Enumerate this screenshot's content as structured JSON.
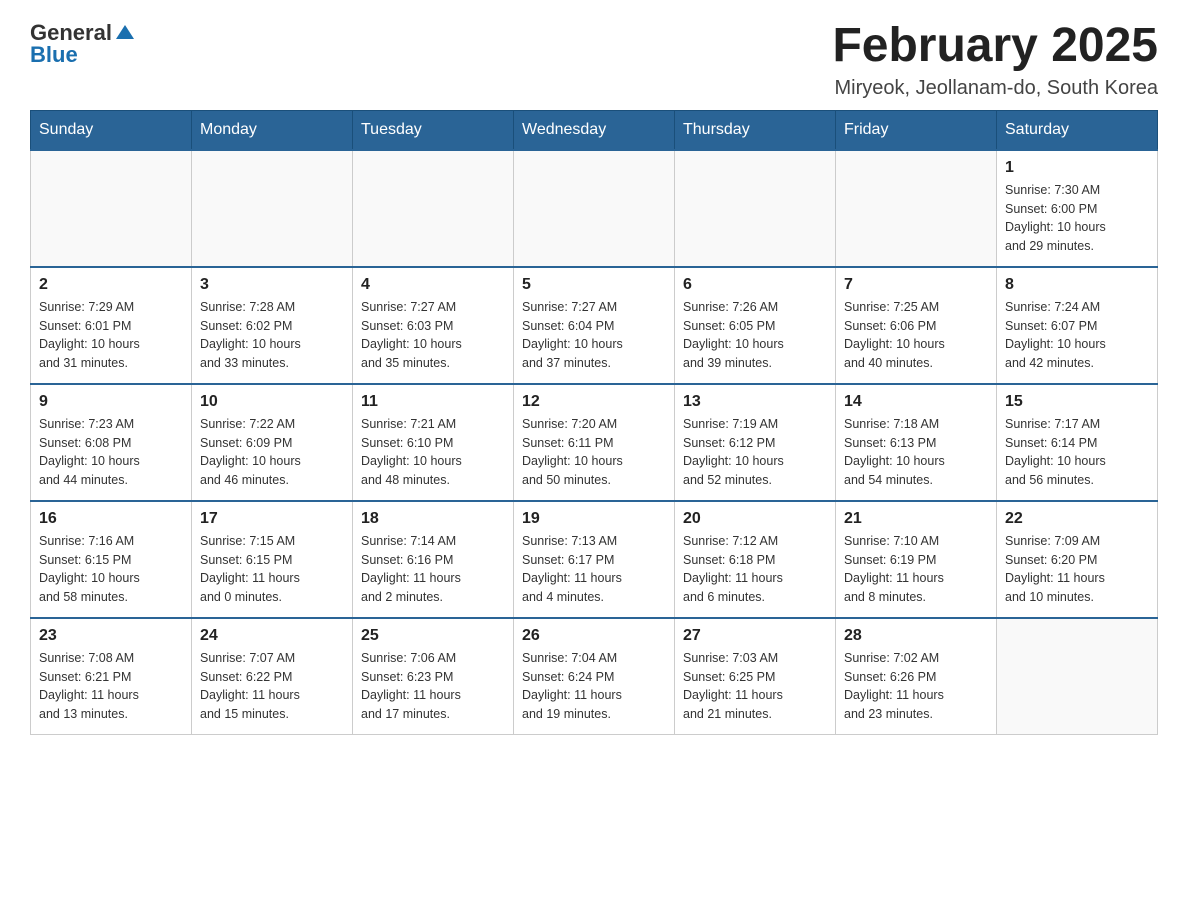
{
  "header": {
    "logo_general": "General",
    "logo_blue": "Blue",
    "month_title": "February 2025",
    "location": "Miryeok, Jeollanam-do, South Korea"
  },
  "weekdays": [
    "Sunday",
    "Monday",
    "Tuesday",
    "Wednesday",
    "Thursday",
    "Friday",
    "Saturday"
  ],
  "weeks": [
    [
      {
        "day": "",
        "info": ""
      },
      {
        "day": "",
        "info": ""
      },
      {
        "day": "",
        "info": ""
      },
      {
        "day": "",
        "info": ""
      },
      {
        "day": "",
        "info": ""
      },
      {
        "day": "",
        "info": ""
      },
      {
        "day": "1",
        "info": "Sunrise: 7:30 AM\nSunset: 6:00 PM\nDaylight: 10 hours\nand 29 minutes."
      }
    ],
    [
      {
        "day": "2",
        "info": "Sunrise: 7:29 AM\nSunset: 6:01 PM\nDaylight: 10 hours\nand 31 minutes."
      },
      {
        "day": "3",
        "info": "Sunrise: 7:28 AM\nSunset: 6:02 PM\nDaylight: 10 hours\nand 33 minutes."
      },
      {
        "day": "4",
        "info": "Sunrise: 7:27 AM\nSunset: 6:03 PM\nDaylight: 10 hours\nand 35 minutes."
      },
      {
        "day": "5",
        "info": "Sunrise: 7:27 AM\nSunset: 6:04 PM\nDaylight: 10 hours\nand 37 minutes."
      },
      {
        "day": "6",
        "info": "Sunrise: 7:26 AM\nSunset: 6:05 PM\nDaylight: 10 hours\nand 39 minutes."
      },
      {
        "day": "7",
        "info": "Sunrise: 7:25 AM\nSunset: 6:06 PM\nDaylight: 10 hours\nand 40 minutes."
      },
      {
        "day": "8",
        "info": "Sunrise: 7:24 AM\nSunset: 6:07 PM\nDaylight: 10 hours\nand 42 minutes."
      }
    ],
    [
      {
        "day": "9",
        "info": "Sunrise: 7:23 AM\nSunset: 6:08 PM\nDaylight: 10 hours\nand 44 minutes."
      },
      {
        "day": "10",
        "info": "Sunrise: 7:22 AM\nSunset: 6:09 PM\nDaylight: 10 hours\nand 46 minutes."
      },
      {
        "day": "11",
        "info": "Sunrise: 7:21 AM\nSunset: 6:10 PM\nDaylight: 10 hours\nand 48 minutes."
      },
      {
        "day": "12",
        "info": "Sunrise: 7:20 AM\nSunset: 6:11 PM\nDaylight: 10 hours\nand 50 minutes."
      },
      {
        "day": "13",
        "info": "Sunrise: 7:19 AM\nSunset: 6:12 PM\nDaylight: 10 hours\nand 52 minutes."
      },
      {
        "day": "14",
        "info": "Sunrise: 7:18 AM\nSunset: 6:13 PM\nDaylight: 10 hours\nand 54 minutes."
      },
      {
        "day": "15",
        "info": "Sunrise: 7:17 AM\nSunset: 6:14 PM\nDaylight: 10 hours\nand 56 minutes."
      }
    ],
    [
      {
        "day": "16",
        "info": "Sunrise: 7:16 AM\nSunset: 6:15 PM\nDaylight: 10 hours\nand 58 minutes."
      },
      {
        "day": "17",
        "info": "Sunrise: 7:15 AM\nSunset: 6:15 PM\nDaylight: 11 hours\nand 0 minutes."
      },
      {
        "day": "18",
        "info": "Sunrise: 7:14 AM\nSunset: 6:16 PM\nDaylight: 11 hours\nand 2 minutes."
      },
      {
        "day": "19",
        "info": "Sunrise: 7:13 AM\nSunset: 6:17 PM\nDaylight: 11 hours\nand 4 minutes."
      },
      {
        "day": "20",
        "info": "Sunrise: 7:12 AM\nSunset: 6:18 PM\nDaylight: 11 hours\nand 6 minutes."
      },
      {
        "day": "21",
        "info": "Sunrise: 7:10 AM\nSunset: 6:19 PM\nDaylight: 11 hours\nand 8 minutes."
      },
      {
        "day": "22",
        "info": "Sunrise: 7:09 AM\nSunset: 6:20 PM\nDaylight: 11 hours\nand 10 minutes."
      }
    ],
    [
      {
        "day": "23",
        "info": "Sunrise: 7:08 AM\nSunset: 6:21 PM\nDaylight: 11 hours\nand 13 minutes."
      },
      {
        "day": "24",
        "info": "Sunrise: 7:07 AM\nSunset: 6:22 PM\nDaylight: 11 hours\nand 15 minutes."
      },
      {
        "day": "25",
        "info": "Sunrise: 7:06 AM\nSunset: 6:23 PM\nDaylight: 11 hours\nand 17 minutes."
      },
      {
        "day": "26",
        "info": "Sunrise: 7:04 AM\nSunset: 6:24 PM\nDaylight: 11 hours\nand 19 minutes."
      },
      {
        "day": "27",
        "info": "Sunrise: 7:03 AM\nSunset: 6:25 PM\nDaylight: 11 hours\nand 21 minutes."
      },
      {
        "day": "28",
        "info": "Sunrise: 7:02 AM\nSunset: 6:26 PM\nDaylight: 11 hours\nand 23 minutes."
      },
      {
        "day": "",
        "info": ""
      }
    ]
  ]
}
